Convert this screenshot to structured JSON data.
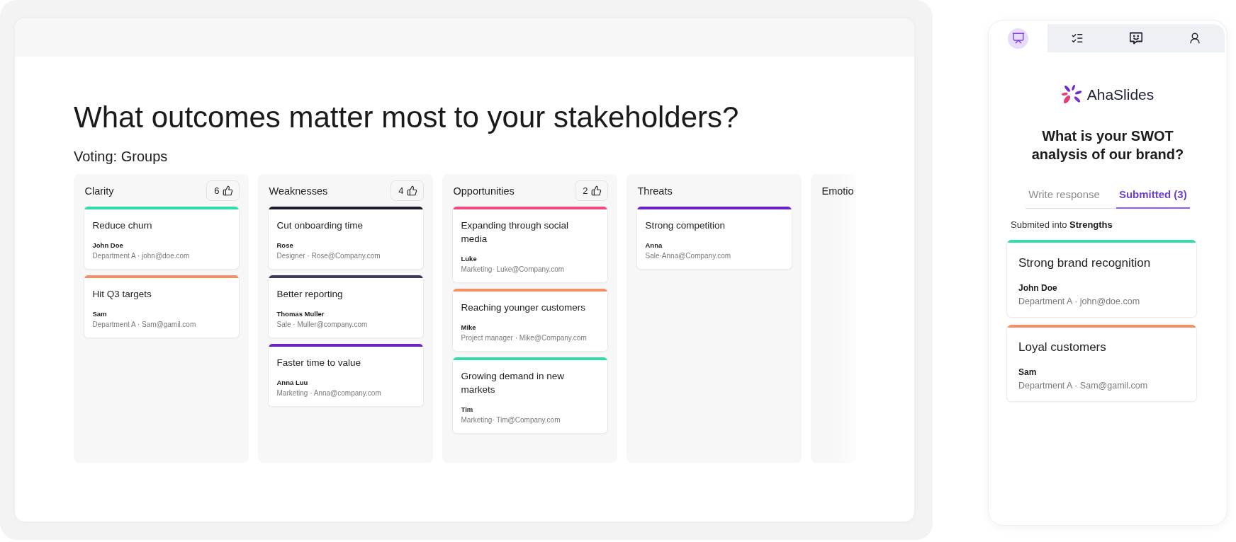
{
  "slide": {
    "title": "What outcomes matter most to your stakeholders?",
    "voting_label": "Voting: Groups",
    "columns": [
      {
        "title": "Clarity",
        "votes": "6",
        "cards": [
          {
            "text": "Reduce churn",
            "name": "John Doe",
            "meta": "Department A · john@doe.com",
            "color": "#2fdcaa"
          },
          {
            "text": "Hit Q3 targets",
            "name": "Sam",
            "meta": "Department A · Sam@gamil.com",
            "color": "#f58f66"
          }
        ]
      },
      {
        "title": "Weaknesses",
        "votes": "4",
        "cards": [
          {
            "text": "Cut onboarding time",
            "name": "Rose",
            "meta": "Designer · Rose@Company.com",
            "color": "#1e1b2e"
          },
          {
            "text": "Better reporting",
            "name": "Thomas Muller",
            "meta": "Sale · Muller@company.com",
            "color": "#3d3a5e"
          },
          {
            "text": "Faster time to value",
            "name": "Anna Luu",
            "meta": "Marketing · Anna@company.com",
            "color": "#6a22c4"
          }
        ]
      },
      {
        "title": "Opportunities",
        "votes": "2",
        "cards": [
          {
            "text": "Expanding through social media",
            "name": "Luke",
            "meta": "Marketing· Luke@Company.com",
            "color": "#ee4a7c"
          },
          {
            "text": "Reaching younger customers",
            "name": "Mike",
            "meta": "Project manager · Mike@Company.com",
            "color": "#f58f66"
          },
          {
            "text": "Growing demand in new markets",
            "name": "Tim",
            "meta": "Marketing· Tim@Company.com",
            "color": "#2fdcaa"
          }
        ]
      },
      {
        "title": "Threats",
        "cards": [
          {
            "text": "Strong competition",
            "name": "Anna",
            "meta": "Sale·Anna@Company.com",
            "color": "#6a22c4"
          }
        ]
      },
      {
        "title": "Emotio"
      }
    ]
  },
  "phone": {
    "nav_tabs": [
      {
        "selected": true
      },
      {
        "selected": false
      },
      {
        "selected": false
      },
      {
        "selected": false
      }
    ],
    "brand": "AhaSlides",
    "question": "What is your SWOT analysis of our brand?",
    "tabs": [
      {
        "label": "Write response",
        "selected": false
      },
      {
        "label": "Submitted (3)",
        "selected": true
      }
    ],
    "submitted_into": "Submited into **Strengths**",
    "responses": [
      {
        "text": "Strong brand recognition",
        "name": "John Doe",
        "meta": "Department A · john@doe.com",
        "color": "#2fdcaa"
      },
      {
        "text": "Loyal customers",
        "name": "Sam",
        "meta": "Department A · Sam@gamil.com",
        "color": "#f58f66"
      }
    ]
  }
}
